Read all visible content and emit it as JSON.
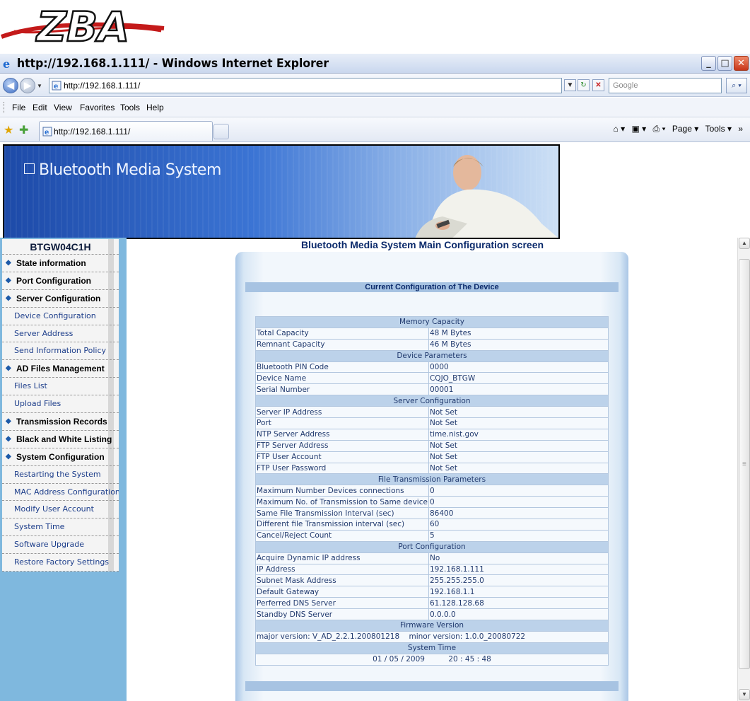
{
  "logo": {
    "text": "ZBA",
    "colors": {
      "stroke": "#c41a1a",
      "letters": "#ffffff",
      "outline": "#111111"
    }
  },
  "window": {
    "title": "http://192.168.1.111/ - Windows Internet Explorer",
    "buttons": {
      "minimize": "_",
      "maximize": "□",
      "close": "✕"
    }
  },
  "address": {
    "url": "http://192.168.1.111/",
    "search_placeholder": "Google"
  },
  "menubar": {
    "items": [
      "File",
      "Edit",
      "View",
      "Favorites",
      "Tools",
      "Help"
    ]
  },
  "favbar": {
    "tab_label": "http://192.168.1.111/",
    "commands": {
      "page": "Page ▾",
      "tools": "Tools ▾"
    }
  },
  "banner": {
    "brand": "Bluetooth Media System"
  },
  "sidebar": {
    "device": "BTGW04C1H",
    "items": [
      {
        "label": "State information",
        "type": "sec"
      },
      {
        "label": "Port Configuration",
        "type": "sec"
      },
      {
        "label": "Server Configuration",
        "type": "sec"
      },
      {
        "label": "Device Configuration",
        "type": "sub"
      },
      {
        "label": "Server Address",
        "type": "sub"
      },
      {
        "label": "Send Information Policy",
        "type": "sub"
      },
      {
        "label": "AD Files Management",
        "type": "sec"
      },
      {
        "label": "Files List",
        "type": "sub"
      },
      {
        "label": "Upload Files",
        "type": "sub"
      },
      {
        "label": "Transmission Records",
        "type": "sec"
      },
      {
        "label": "Black and White Listing",
        "type": "sec"
      },
      {
        "label": "System Configuration",
        "type": "sec"
      },
      {
        "label": "Restarting the System",
        "type": "sub"
      },
      {
        "label": "MAC Address Configuration",
        "type": "sub"
      },
      {
        "label": "Modify User Account",
        "type": "sub"
      },
      {
        "label": "System Time",
        "type": "sub"
      },
      {
        "label": "Software Upgrade",
        "type": "sub"
      },
      {
        "label": "Restore Factory Settings",
        "type": "sub"
      }
    ]
  },
  "main": {
    "heading": "Bluetooth Media System Main Configuration screen",
    "panel_title": "Current Configuration of The Device",
    "sections": [
      {
        "title": "Memory Capacity",
        "rows": [
          [
            "Total Capacity",
            "48 M Bytes"
          ],
          [
            "Remnant Capacity",
            "46 M Bytes"
          ]
        ]
      },
      {
        "title": "Device Parameters",
        "rows": [
          [
            "Bluetooth PIN Code",
            "0000"
          ],
          [
            "Device Name",
            "CQJO_BTGW"
          ],
          [
            "Serial Number",
            "00001"
          ]
        ]
      },
      {
        "title": "Server Configuration",
        "rows": [
          [
            "Server IP Address",
            "Not Set"
          ],
          [
            "Port",
            "Not Set"
          ],
          [
            "NTP Server Address",
            "time.nist.gov"
          ],
          [
            "FTP Server Address",
            "Not Set"
          ],
          [
            "FTP User Account",
            "Not Set"
          ],
          [
            "FTP User Password",
            "Not Set"
          ]
        ]
      },
      {
        "title": "File Transmission Parameters",
        "rows": [
          [
            "Maximum Number Devices connections",
            "0"
          ],
          [
            "Maximum No. of Transmission to Same device",
            "0"
          ],
          [
            "Same File Transmission Interval (sec)",
            "86400"
          ],
          [
            "Different file Transmission interval (sec)",
            "60"
          ],
          [
            "Cancel/Reject Count",
            "5"
          ]
        ]
      },
      {
        "title": "Port Configuration",
        "rows": [
          [
            "Acquire Dynamic IP address",
            "No"
          ],
          [
            "IP Address",
            "192.168.1.111"
          ],
          [
            "Subnet Mask Address",
            "255.255.255.0"
          ],
          [
            "Default Gateway",
            "192.168.1.1"
          ],
          [
            "Perferred DNS Server",
            "61.128.128.68"
          ],
          [
            "Standby DNS Server",
            "0.0.0.0"
          ]
        ]
      },
      {
        "title": "Firmware Version",
        "line": "major version: V_AD_2.2.1.200801218    minor version: 1.0.0_20080722"
      },
      {
        "title": "System Time",
        "line": "01 / 05 / 2009          20 : 45 : 48"
      }
    ]
  }
}
